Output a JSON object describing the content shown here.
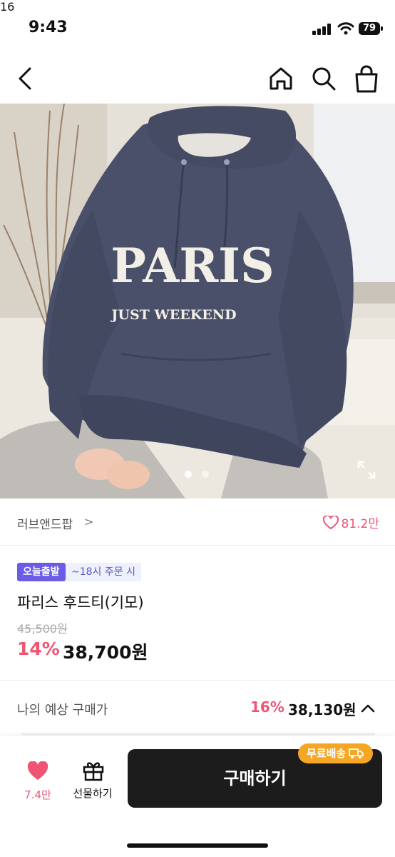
{
  "status_bar": {
    "time": "9:43",
    "battery": "79"
  },
  "nav": {
    "cart_badge": "16"
  },
  "colors": {
    "accent_pink": "#ef5573",
    "badge_purple": "#6b5ce7",
    "free_ship_orange": "#f5a623",
    "buy_button": "#1c1c1c"
  },
  "icons": [
    "back-icon",
    "home-icon",
    "search-icon",
    "cart-icon",
    "heart-icon",
    "gift-icon",
    "expand-icon",
    "chevron-up-icon",
    "truck-icon"
  ],
  "gallery": {
    "current_index": 1,
    "total": 2,
    "print_text_1": "PARIS",
    "print_text_2": "JUST WEEKEND"
  },
  "brand": {
    "name": "러브앤드팝",
    "chevron": ">",
    "likes": "81.2만"
  },
  "product": {
    "badge_today": "오늘출발",
    "badge_cutoff": "~18시 주문 시",
    "title": "파리스 후드티(기모)",
    "original_price": "45,500원",
    "discount": "14%",
    "price": "38,700원"
  },
  "expected": {
    "label": "나의 예상 구매가",
    "discount": "16%",
    "price": "38,130원"
  },
  "bottom": {
    "wish_count": "7.4만",
    "gift_label": "선물하기",
    "buy_label": "구매하기",
    "free_shipping": "무료배송"
  }
}
